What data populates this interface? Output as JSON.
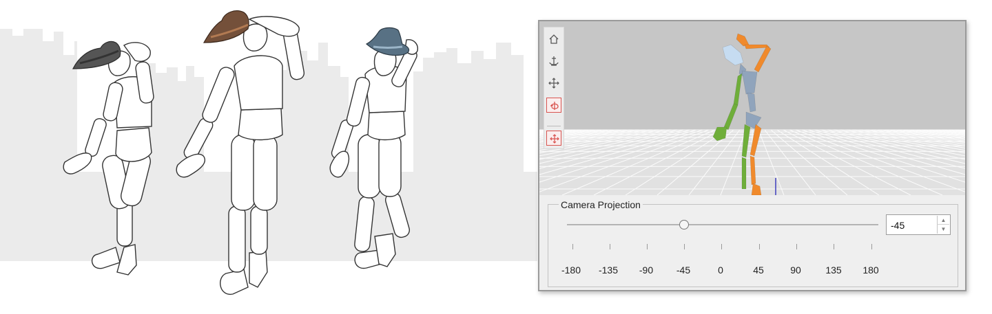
{
  "illustration": {
    "figures": [
      {
        "name": "figure-1",
        "hat_color": "#555555",
        "hat_band": "#333333"
      },
      {
        "name": "figure-2",
        "hat_color": "#74503a",
        "hat_band": "#b27a52"
      },
      {
        "name": "figure-3",
        "hat_color": "#587184",
        "hat_band": "#9bb5c8"
      }
    ]
  },
  "viewport": {
    "tools": [
      {
        "icon": "home-icon",
        "active": false
      },
      {
        "icon": "anchor-icon",
        "active": false
      },
      {
        "icon": "move-icon",
        "active": false
      },
      {
        "icon": "rotate-icon",
        "active": true
      },
      {
        "icon": "pan-icon",
        "active": true
      }
    ],
    "colors": {
      "left_limbs": "#6fae3a",
      "right_limbs": "#f08a2c",
      "torso": "#90a4bc",
      "head": "#c6dcf1"
    }
  },
  "camera_projection": {
    "title": "Camera Projection",
    "value": "-45",
    "spin_up": "▲",
    "spin_down": "▼",
    "tick_labels": [
      "-180",
      "-135",
      "-90",
      "-45",
      "0",
      "45",
      "90",
      "135",
      "180"
    ]
  }
}
